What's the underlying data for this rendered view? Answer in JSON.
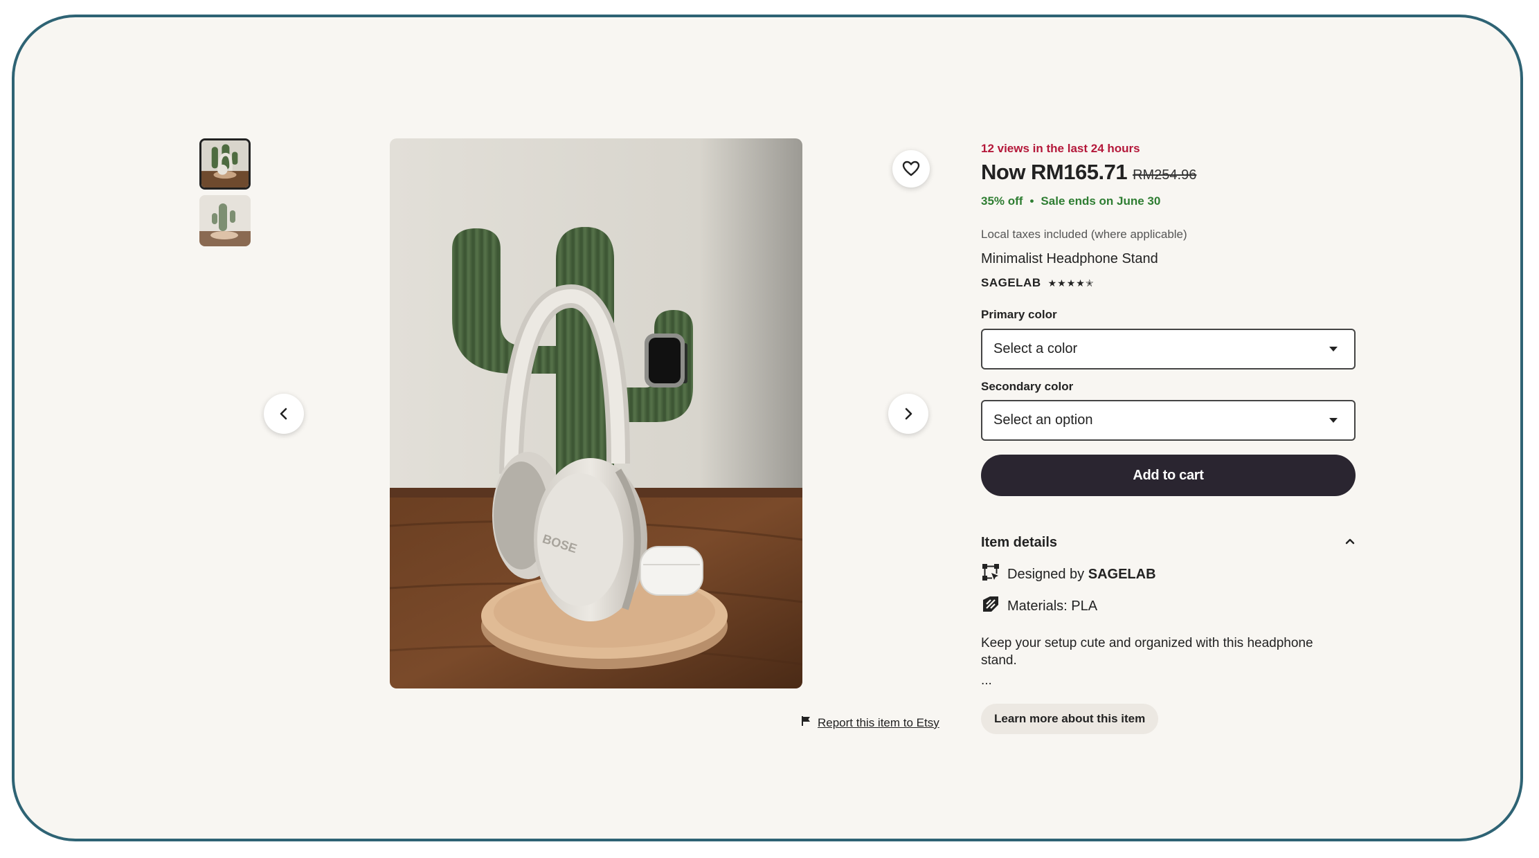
{
  "gallery": {
    "thumbnails": [
      {
        "label": "thumbnail-1",
        "selected": true
      },
      {
        "label": "thumbnail-2",
        "selected": false
      }
    ],
    "prev_icon": "chevron-left-icon",
    "next_icon": "chevron-right-icon",
    "favorite_icon": "heart-icon",
    "report_icon": "flag-icon",
    "report_label": "Report this item to Etsy"
  },
  "listing": {
    "views_text": "12 views in the last 24 hours",
    "price_now": "Now RM165.71",
    "price_original": "RM254.96",
    "discount": "35% off",
    "separator": "•",
    "sale_ends": "Sale ends on June 30",
    "taxes_note": "Local taxes included (where applicable)",
    "title": "Minimalist Headphone Stand",
    "shop_name": "SAGELAB",
    "rating_stars": "★★★★✭"
  },
  "options": {
    "primary_label": "Primary color",
    "primary_value": "Select a color",
    "secondary_label": "Secondary color",
    "secondary_value": "Select an option"
  },
  "cart": {
    "add_label": "Add to cart"
  },
  "details": {
    "heading": "Item details",
    "designed_prefix": "Designed by ",
    "designer": "SAGELAB",
    "materials": "Materials: PLA",
    "description": "Keep your setup cute and organized with this headphone stand.",
    "ellipsis": "...",
    "learn_more": "Learn more about this item"
  },
  "colors": {
    "accent_views": "#b4183a",
    "sale_green": "#2e7d32",
    "cart_button": "#2a2530",
    "frame_border": "#2e6374"
  }
}
